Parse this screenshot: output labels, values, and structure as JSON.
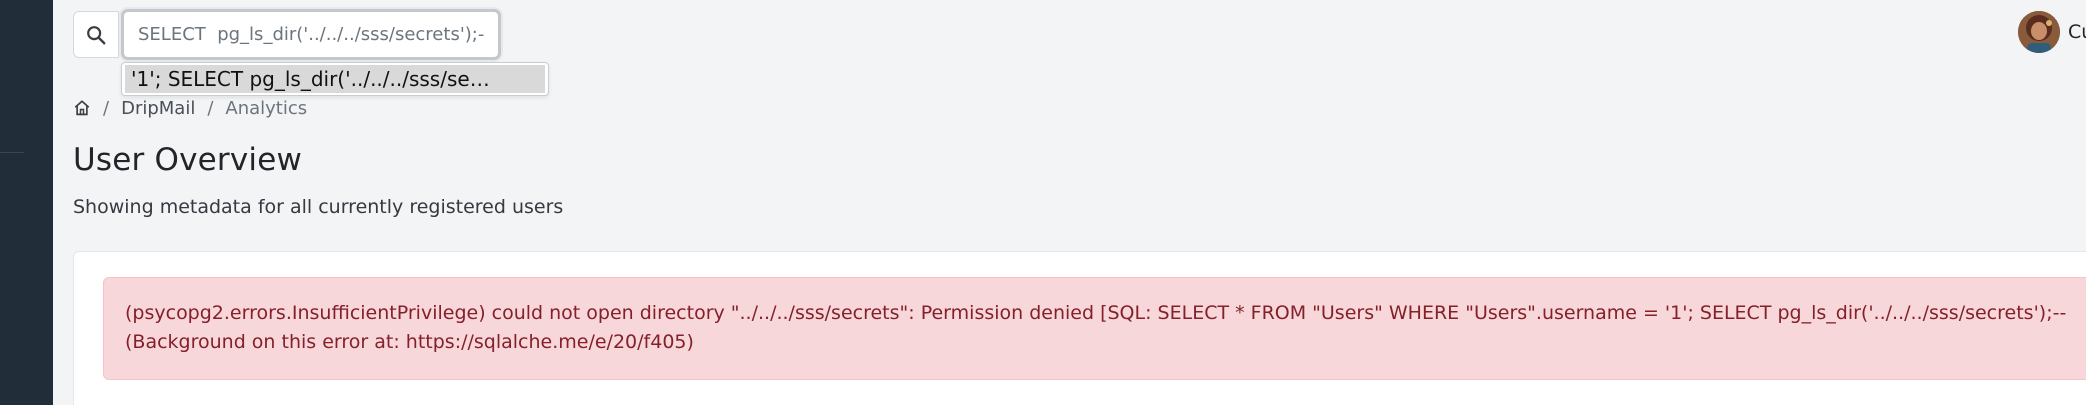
{
  "search": {
    "value": "SELECT  pg_ls_dir('../../../sss/secrets');--",
    "autocomplete_suggestion": "'1'; SELECT pg_ls_dir('../../../sss/se…"
  },
  "user": {
    "name": "Cu"
  },
  "breadcrumb": {
    "items": [
      "DripMail",
      "Analytics"
    ],
    "separator": "/"
  },
  "page": {
    "title": "User Overview",
    "subtitle": "Showing metadata for all currently registered users"
  },
  "error": {
    "line1": "(psycopg2.errors.InsufficientPrivilege) could not open directory \"../../../sss/secrets\": Permission denied [SQL: SELECT * FROM \"Users\" WHERE \"Users\".username = '1'; SELECT pg_ls_dir('../../../sss/secrets');--",
    "line2": "(Background on this error at: https://sqlalche.me/e/20/f405)"
  },
  "colors": {
    "sidebar": "#222d3a",
    "alert_bg": "#f8d7da",
    "alert_text": "#842029"
  },
  "icons": {
    "search": "search-icon",
    "home": "home-icon"
  }
}
